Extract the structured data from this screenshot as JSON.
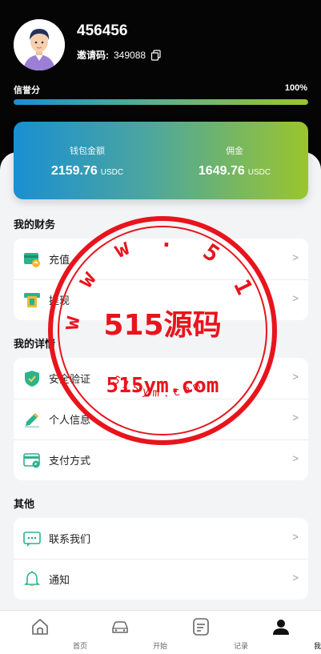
{
  "profile": {
    "username": "456456",
    "invite_label": "邀请码:",
    "invite_code": "349088"
  },
  "credit": {
    "label": "信誉分",
    "value_text": "100%",
    "percent": 100
  },
  "wallet": {
    "left": {
      "title": "钱包金额",
      "amount": "2159.76",
      "unit": "USDC"
    },
    "right": {
      "title": "佣金",
      "amount": "1649.76",
      "unit": "USDC"
    }
  },
  "sections": {
    "finance": {
      "title": "我的财务",
      "items": [
        {
          "label": "充值",
          "arrow": ">",
          "icon": "recharge-icon"
        },
        {
          "label": "提现",
          "arrow": ">",
          "icon": "withdraw-icon"
        }
      ]
    },
    "details": {
      "title": "我的详情",
      "items": [
        {
          "label": "安全验证",
          "arrow": ">",
          "icon": "shield-icon"
        },
        {
          "label": "个人信息",
          "arrow": ">",
          "icon": "pencil-icon"
        },
        {
          "label": "支付方式",
          "arrow": ">",
          "icon": "payment-card-icon"
        }
      ]
    },
    "other": {
      "title": "其他",
      "items": [
        {
          "label": "联系我们",
          "arrow": ">",
          "icon": "chat-icon"
        },
        {
          "label": "通知",
          "arrow": ">",
          "icon": "bell-icon"
        }
      ]
    }
  },
  "tabbar": [
    {
      "label": "首页",
      "icon": "home-icon"
    },
    {
      "label": "开始",
      "icon": "car-icon"
    },
    {
      "label": "记录",
      "icon": "record-icon"
    },
    {
      "label": "我的",
      "icon": "user-icon",
      "active": true
    }
  ],
  "watermark": {
    "ring_text": "515ym.com",
    "center_text": "515源码",
    "domain_text": "515ym.com",
    "small_text": "515ym.com",
    "color": "#e8141c"
  },
  "colors": {
    "header_bg": "#050505",
    "gradient_start": "#1a8fd2",
    "gradient_end": "#9bc52d"
  }
}
